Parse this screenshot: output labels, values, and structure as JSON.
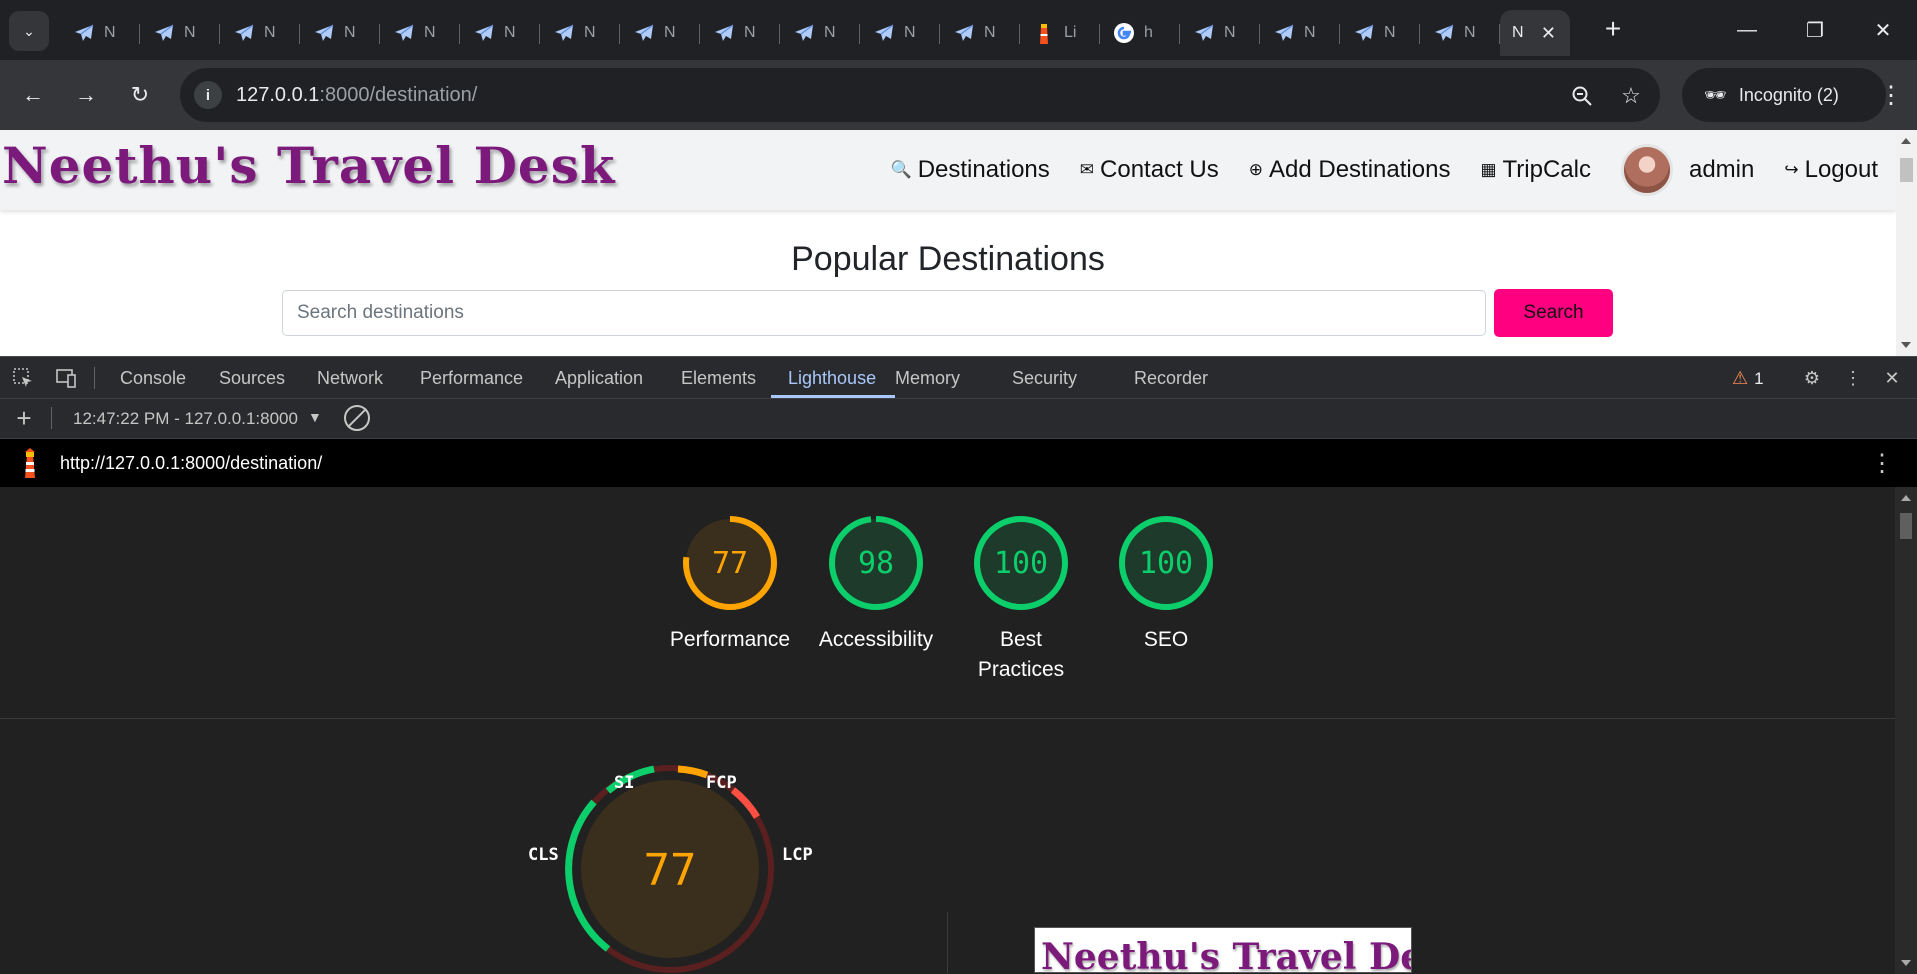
{
  "browser": {
    "tabs": [
      {
        "title": "N",
        "icon": "airplane-icon"
      },
      {
        "title": "N",
        "icon": "airplane-icon"
      },
      {
        "title": "N",
        "icon": "airplane-icon"
      },
      {
        "title": "N",
        "icon": "airplane-icon"
      },
      {
        "title": "N",
        "icon": "airplane-icon"
      },
      {
        "title": "N",
        "icon": "airplane-icon"
      },
      {
        "title": "N",
        "icon": "airplane-icon"
      },
      {
        "title": "N",
        "icon": "airplane-icon"
      },
      {
        "title": "N",
        "icon": "airplane-icon"
      },
      {
        "title": "N",
        "icon": "airplane-icon"
      },
      {
        "title": "N",
        "icon": "airplane-icon"
      },
      {
        "title": "N",
        "icon": "airplane-icon"
      },
      {
        "title": "Li",
        "icon": "lighthouse-icon"
      },
      {
        "title": "h",
        "icon": "google-icon"
      },
      {
        "title": "N",
        "icon": "airplane-icon"
      },
      {
        "title": "N",
        "icon": "airplane-icon"
      },
      {
        "title": "N",
        "icon": "airplane-icon"
      },
      {
        "title": "N",
        "icon": "airplane-icon"
      }
    ],
    "active_tab": {
      "title": "N"
    },
    "url": {
      "host": "127.0.0.1",
      "path": ":8000/destination/"
    },
    "incognito_label": "Incognito (2)"
  },
  "site": {
    "brand": "Neethu's Travel Desk",
    "nav": {
      "destinations": "Destinations",
      "contact": "Contact Us",
      "add": "Add Destinations",
      "tripcalc": "TripCalc",
      "user": "admin",
      "logout": "Logout"
    },
    "heading": "Popular Destinations",
    "search": {
      "placeholder": "Search destinations",
      "button": "Search"
    },
    "colors": {
      "brand": "#7b1a7b",
      "search_button": "#ff0080"
    }
  },
  "devtools": {
    "tabs": [
      "Console",
      "Sources",
      "Network",
      "Performance",
      "Application",
      "Elements",
      "Lighthouse",
      "Memory",
      "Security",
      "Recorder"
    ],
    "active_tab": "Lighthouse",
    "warnings": "1",
    "report_selector": "12:47:22 PM - 127.0.0.1:8000",
    "report_url": "http://127.0.0.1:8000/destination/"
  },
  "lighthouse": {
    "scores": [
      {
        "label": "Performance",
        "score": 77,
        "color": "#ffa400"
      },
      {
        "label": "Accessibility",
        "score": 98,
        "color": "#0cce6b"
      },
      {
        "label": "Best Practices",
        "score": 100,
        "color": "#0cce6b"
      },
      {
        "label": "SEO",
        "score": 100,
        "color": "#0cce6b"
      }
    ],
    "performance_gauge": {
      "score": 77,
      "metrics": [
        "SI",
        "FCP",
        "LCP",
        "CLS"
      ]
    },
    "screenshot_brand": "Neethu's Travel Desk"
  }
}
